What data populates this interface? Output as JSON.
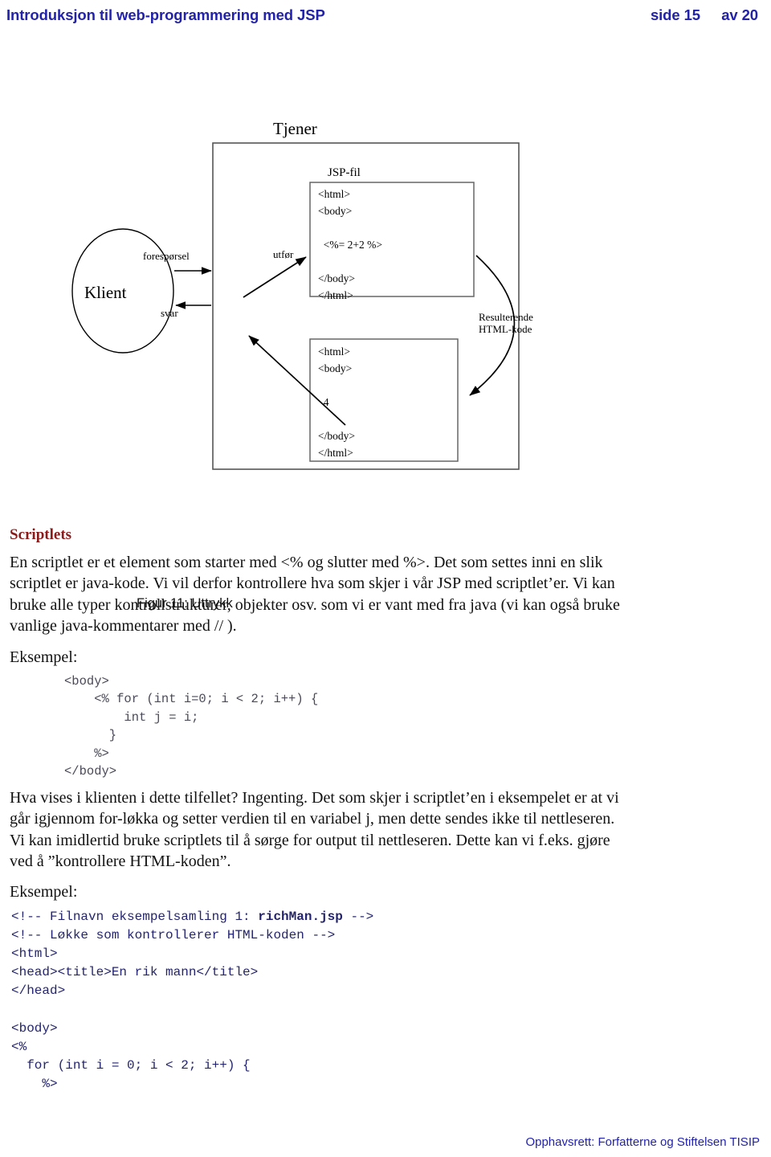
{
  "header": {
    "title": "Introduksjon til web-programmering med JSP",
    "page_label": "side 15",
    "of_label": "av 20"
  },
  "figure": {
    "caption": "Figur 11: Uttrykk",
    "labels": {
      "server": "Tjener",
      "client": "Klient",
      "jsp_file": "JSP-fil",
      "execute": "utfør",
      "request": "forespørsel",
      "response": "svar",
      "result_line1": "Resulterende",
      "result_line2": "HTML-kode"
    },
    "jsp_code": "<html>\n<body>\n\n  <%= 2+2 %>\n\n</body>\n</html>",
    "output_code": "<html>\n<body>\n\n  4\n\n</body>\n</html>"
  },
  "section": {
    "title": "Scriptlets",
    "paragraph1": "En scriptlet er et element som starter med <% og slutter med %>. Det som settes inni en slik scriptlet er java-kode. Vi vil derfor kontrollere hva som skjer i vår JSP med scriptlet’er. Vi kan bruke alle typer kontrollstrukturer, objekter osv. som vi er vant med fra java (vi kan også bruke vanlige java-kommentarer med // ).",
    "example_label_1": "Eksempel:",
    "code_block_1": "<body>\n    <% for (int i=0; i < 2; i++) {\n        int j = i;\n      }\n    %>\n</body>",
    "paragraph2": "Hva vises i klienten i dette tilfellet? Ingenting. Det som skjer i scriptlet’en i eksempelet er at vi går igjennom for-løkka og setter verdien til en variabel j, men dette sendes ikke til nettleseren. Vi kan imidlertid bruke scriptlets til å sørge for output til nettleseren. Dette kan vi f.eks. gjøre ved å ”kontrollere HTML-koden”.",
    "example_label_2": "Eksempel:",
    "code_block_2_pre": "<!-- Filnavn eksempelsamling 1: ",
    "code_block_2_bold": "richMan.jsp",
    "code_block_2_post": " -->\n<!-- Løkke som kontrollerer HTML-koden -->\n<html>\n<head><title>En rik mann</title>\n</head>\n\n<body>\n<%\n  for (int i = 0; i < 2; i++) {\n    %>"
  },
  "footer": {
    "copyright": "Opphavsrett: Forfatterne og Stiftelsen TISIP"
  },
  "colors": {
    "header_blue": "#2222aa",
    "heading_maroon": "#8b1a1a",
    "code_gray": "#4a4a58",
    "code_blue": "#24246e"
  }
}
